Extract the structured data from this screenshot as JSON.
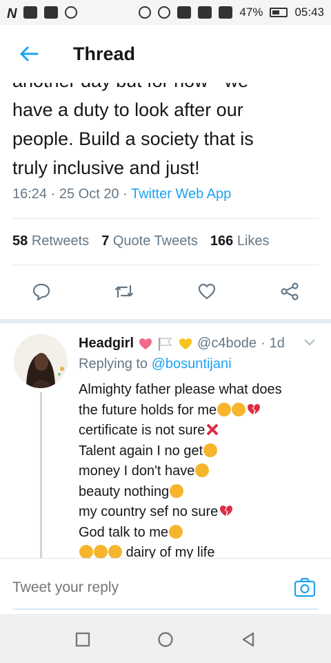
{
  "status_bar": {
    "battery": "47%",
    "time": "05:43"
  },
  "header": {
    "title": "Thread"
  },
  "tweet": {
    "lines": [
      "another day but for now - we",
      "have a duty to look after our",
      "people. Build a society that is",
      "truly inclusive and just!"
    ],
    "time": "16:24",
    "date": "25 Oct 20",
    "source": "Twitter Web App",
    "retweets_count": "58",
    "retweets_label": "Retweets",
    "quotes_count": "7",
    "quotes_label": "Quote Tweets",
    "likes_count": "166",
    "likes_label": "Likes"
  },
  "reply": {
    "name": "Headgirl",
    "handle": "@c4bode",
    "age": "1d",
    "replying_prefix": "Replying to",
    "replying_to": "@bosuntijani",
    "lines": [
      "Almighty father please what does",
      "the future holds for me",
      "certificate is not sure",
      "Talent again I no get",
      "money I don't have",
      "beauty nothing",
      "my country sef no sure",
      "God talk to me",
      "dairy of my life"
    ]
  },
  "compose": {
    "placeholder": "Tweet your reply"
  },
  "colors": {
    "accent": "#1da1f2",
    "muted": "#657786",
    "text": "#14171a"
  }
}
